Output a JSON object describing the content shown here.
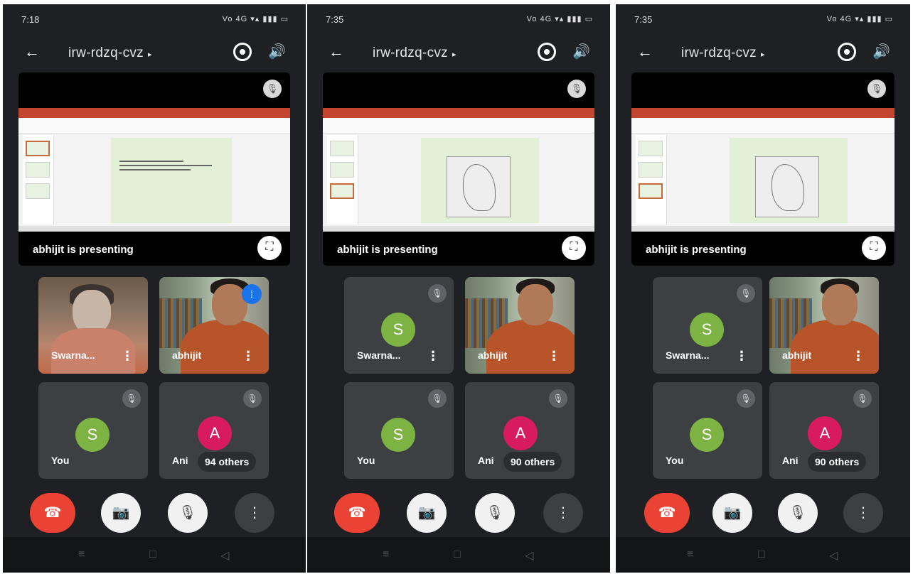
{
  "screens": [
    {
      "time": "7:18",
      "status_icons": "Vo 4G ▾▴ ▮▮▮ ▭",
      "meeting_code": "irw-rdzq-cvz",
      "presenting_label": "abhijit is presenting",
      "tiles": [
        {
          "name": "Swarna..."
        },
        {
          "name": "abhijit"
        },
        {
          "name": "You",
          "initial": "S"
        },
        {
          "name": "Ani",
          "initial": "A"
        }
      ],
      "others_label": "94 others"
    },
    {
      "time": "7:35",
      "status_icons": "Vo 4G ▾▴ ▮▮▮ ▭",
      "meeting_code": "irw-rdzq-cvz",
      "presenting_label": "abhijit is presenting",
      "tiles": [
        {
          "name": "Swarna...",
          "initial": "S"
        },
        {
          "name": "abhijit"
        },
        {
          "name": "You",
          "initial": "S"
        },
        {
          "name": "Ani",
          "initial": "A"
        }
      ],
      "others_label": "90 others"
    },
    {
      "time": "7:35",
      "status_icons": "Vo 4G ▾▴ ▮▮▮ ▭",
      "meeting_code": "irw-rdzq-cvz",
      "presenting_label": "abhijit is presenting",
      "tiles": [
        {
          "name": "Swarna...",
          "initial": "S"
        },
        {
          "name": "abhijit"
        },
        {
          "name": "You",
          "initial": "S"
        },
        {
          "name": "Ani",
          "initial": "A"
        }
      ],
      "others_label": "90 others"
    }
  ],
  "icons": {
    "back": "←",
    "caret": "▸",
    "speaker": "🔊",
    "mic_off": "🎙",
    "more": "⋮",
    "end_call": "☎",
    "camera_off": "📷",
    "fullscreen": "⛶",
    "speaking": "⁞",
    "nav_menu": "≡",
    "nav_home": "□",
    "nav_back": "◁"
  },
  "colors": {
    "end_call": "#ea4335",
    "avatar_green": "#7cb342",
    "avatar_pink": "#d81b60",
    "background": "#1e2023"
  }
}
